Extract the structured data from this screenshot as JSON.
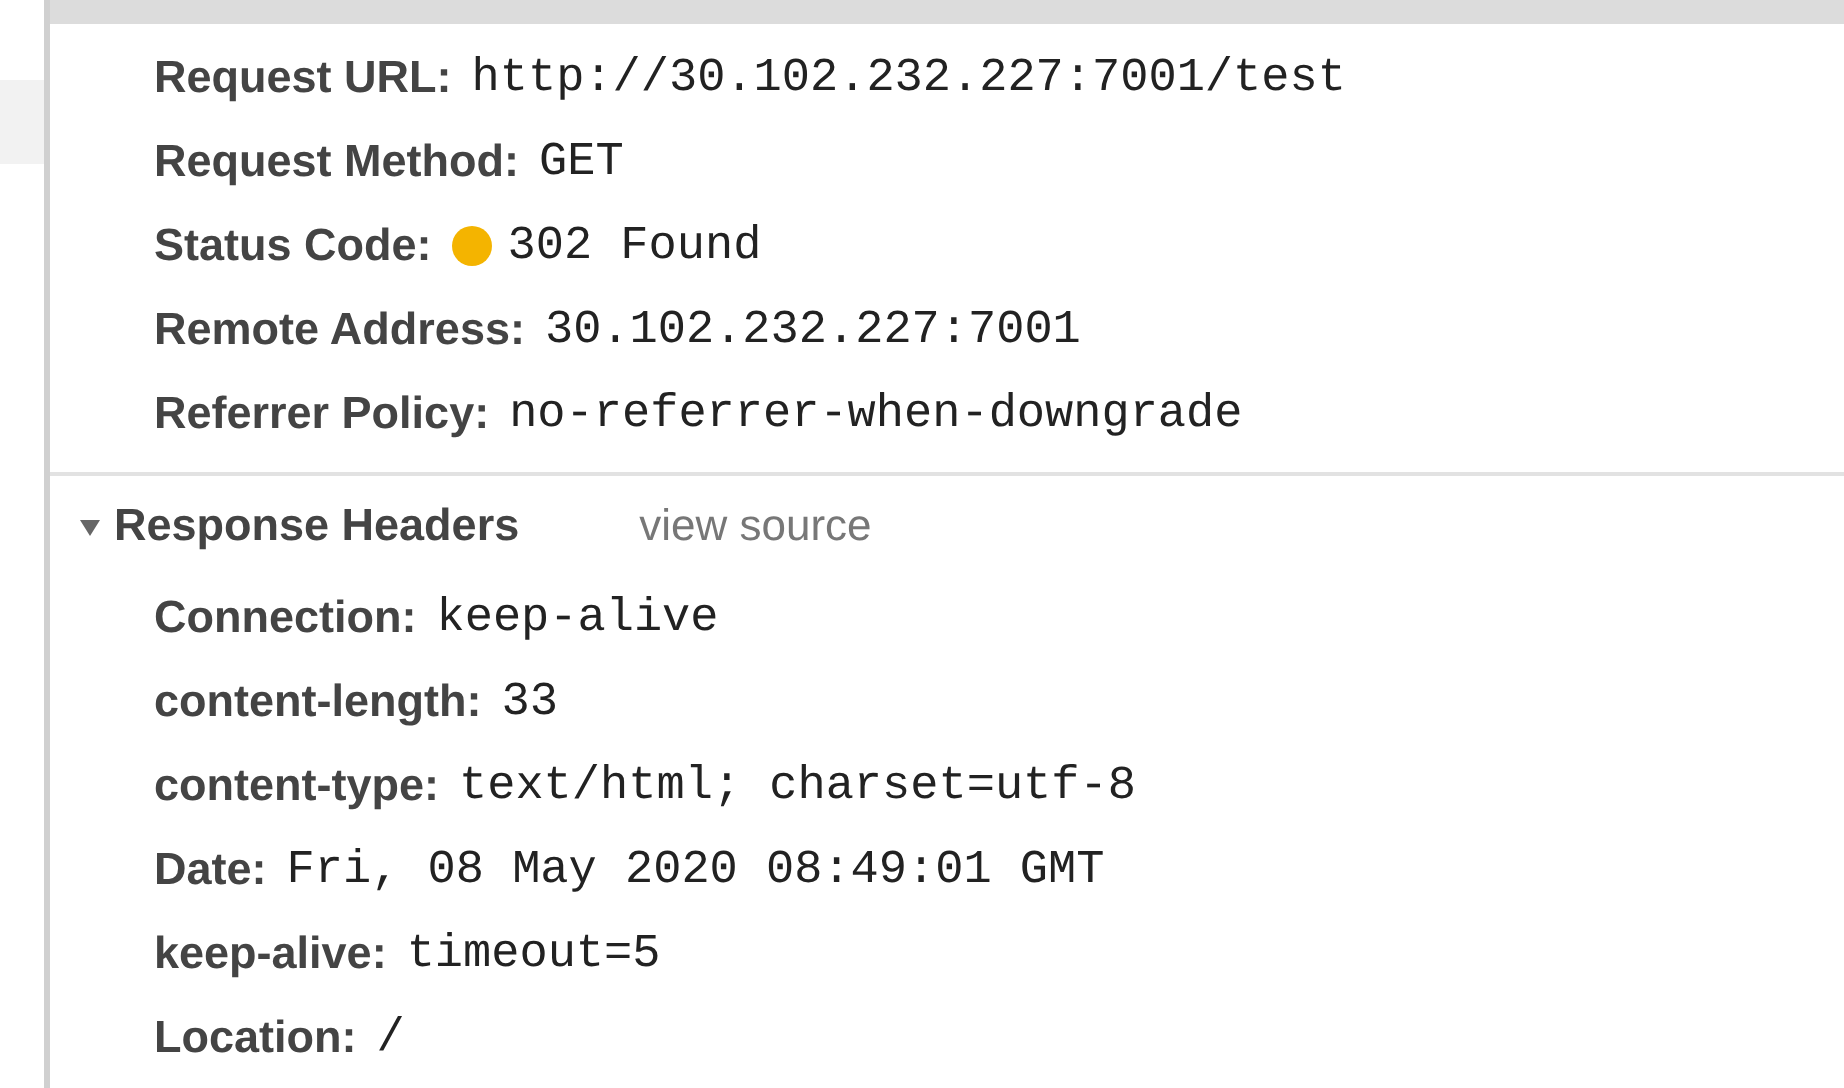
{
  "general_headers": [
    {
      "name": "Request URL:",
      "value": "http://30.102.232.227:7001/test"
    },
    {
      "name": "Request Method:",
      "value": "GET"
    },
    {
      "name": "Status Code:",
      "value": "302 Found",
      "color": "#f4b400"
    },
    {
      "name": "Remote Address:",
      "value": "30.102.232.227:7001"
    },
    {
      "name": "Referrer Policy:",
      "value": "no-referrer-when-downgrade"
    }
  ],
  "response_headers": {
    "title": "Response Headers",
    "expanded": true,
    "link": "view source",
    "items": [
      {
        "name": "Connection:",
        "value": "keep-alive"
      },
      {
        "name": "content-length:",
        "value": "33"
      },
      {
        "name": "content-type:",
        "value": "text/html; charset=utf-8"
      },
      {
        "name": "Date:",
        "value": "Fri, 08 May 2020 08:49:01 GMT"
      },
      {
        "name": "keep-alive:",
        "value": "timeout=5"
      },
      {
        "name": "Location:",
        "value": "/"
      }
    ]
  }
}
